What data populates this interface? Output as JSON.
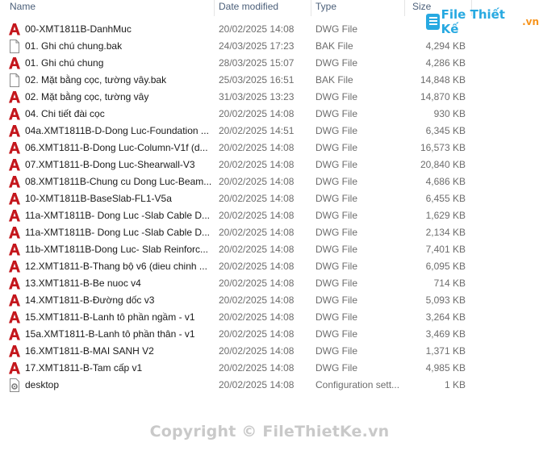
{
  "columns": {
    "name": "Name",
    "date": "Date modified",
    "type": "Type",
    "size": "Size"
  },
  "files": [
    {
      "name": "00-XMT1811B-DanhMuc",
      "date": "20/02/2025 14:08",
      "type": "DWG File",
      "size": "",
      "icon": "dwg-icon"
    },
    {
      "name": "01. Ghi chú chung.bak",
      "date": "24/03/2025 17:23",
      "type": "BAK File",
      "size": "4,294 KB",
      "icon": "file-icon"
    },
    {
      "name": "01. Ghi chú chung",
      "date": "28/03/2025 15:07",
      "type": "DWG File",
      "size": "4,286 KB",
      "icon": "dwg-icon"
    },
    {
      "name": "02. Mặt bằng cọc, tường vây.bak",
      "date": "25/03/2025 16:51",
      "type": "BAK File",
      "size": "14,848 KB",
      "icon": "file-icon"
    },
    {
      "name": "02. Mặt bằng cọc, tường vây",
      "date": "31/03/2025 13:23",
      "type": "DWG File",
      "size": "14,870 KB",
      "icon": "dwg-icon"
    },
    {
      "name": "04. Chi tiết đài cọc",
      "date": "20/02/2025 14:08",
      "type": "DWG File",
      "size": "930 KB",
      "icon": "dwg-icon"
    },
    {
      "name": "04a.XMT1811B-D-Dong Luc-Foundation ...",
      "date": "20/02/2025 14:51",
      "type": "DWG File",
      "size": "6,345 KB",
      "icon": "dwg-icon"
    },
    {
      "name": "06.XMT1811-B-Dong Luc-Column-V1f (d...",
      "date": "20/02/2025 14:08",
      "type": "DWG File",
      "size": "16,573 KB",
      "icon": "dwg-icon"
    },
    {
      "name": "07.XMT1811-B-Dong Luc-Shearwall-V3",
      "date": "20/02/2025 14:08",
      "type": "DWG File",
      "size": "20,840 KB",
      "icon": "dwg-icon"
    },
    {
      "name": "08.XMT1811B-Chung cu Dong Luc-Beam...",
      "date": "20/02/2025 14:08",
      "type": "DWG File",
      "size": "4,686 KB",
      "icon": "dwg-icon"
    },
    {
      "name": "10-XMT1811B-BaseSlab-FL1-V5a",
      "date": "20/02/2025 14:08",
      "type": "DWG File",
      "size": "6,455 KB",
      "icon": "dwg-icon"
    },
    {
      "name": "11a-XMT1811B- Dong Luc -Slab Cable D...",
      "date": "20/02/2025 14:08",
      "type": "DWG File",
      "size": "1,629 KB",
      "icon": "dwg-icon"
    },
    {
      "name": "11a-XMT1811B- Dong Luc -Slab Cable D...",
      "date": "20/02/2025 14:08",
      "type": "DWG File",
      "size": "2,134 KB",
      "icon": "dwg-icon"
    },
    {
      "name": "11b-XMT1811B-Dong Luc- Slab Reinforc...",
      "date": "20/02/2025 14:08",
      "type": "DWG File",
      "size": "7,401 KB",
      "icon": "dwg-icon"
    },
    {
      "name": "12.XMT1811-B-Thang bộ v6 (dieu chinh ...",
      "date": "20/02/2025 14:08",
      "type": "DWG File",
      "size": "6,095 KB",
      "icon": "dwg-icon"
    },
    {
      "name": "13.XMT1811-B-Be nuoc v4",
      "date": "20/02/2025 14:08",
      "type": "DWG File",
      "size": "714 KB",
      "icon": "dwg-icon"
    },
    {
      "name": "14.XMT1811-B-Đường dốc v3",
      "date": "20/02/2025 14:08",
      "type": "DWG File",
      "size": "5,093 KB",
      "icon": "dwg-icon"
    },
    {
      "name": "15.XMT1811-B-Lanh tô phần ngầm - v1",
      "date": "20/02/2025 14:08",
      "type": "DWG File",
      "size": "3,264 KB",
      "icon": "dwg-icon"
    },
    {
      "name": "15a.XMT1811-B-Lanh tô phần thân - v1",
      "date": "20/02/2025 14:08",
      "type": "DWG File",
      "size": "3,469 KB",
      "icon": "dwg-icon"
    },
    {
      "name": "16.XMT1811-B-MAI SANH V2",
      "date": "20/02/2025 14:08",
      "type": "DWG File",
      "size": "1,371 KB",
      "icon": "dwg-icon"
    },
    {
      "name": "17.XMT1811-B-Tam cấp v1",
      "date": "20/02/2025 14:08",
      "type": "DWG File",
      "size": "4,985 KB",
      "icon": "dwg-icon"
    },
    {
      "name": "desktop",
      "date": "20/02/2025 14:08",
      "type": "Configuration sett...",
      "size": "1 KB",
      "icon": "config-file-icon"
    }
  ],
  "watermark": {
    "logo_text": "File Thiết Kế",
    "logo_suffix": ".vn",
    "copyright": "Copyright © FileThietKe.vn"
  },
  "colors": {
    "dwg_red": "#c4161c",
    "header_text": "#4c607a",
    "secondary_text": "#6d6d6d",
    "logo_blue": "#27a9e1",
    "logo_orange": "#f7941d",
    "watermark_gray": "#c9c9c9"
  }
}
